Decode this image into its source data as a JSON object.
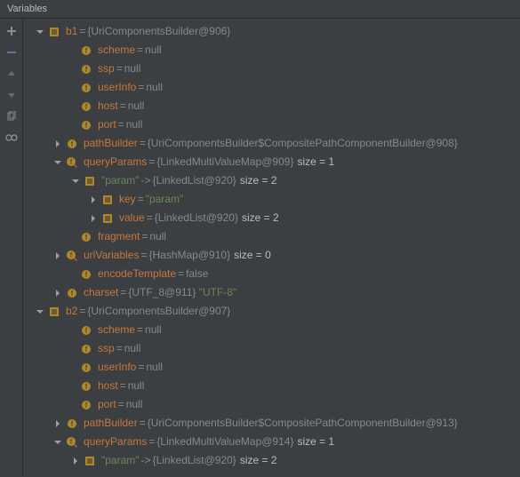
{
  "header": {
    "title": "Variables"
  },
  "gutter": {
    "icons": [
      "plus-icon",
      "minus-icon",
      "up-icon",
      "down-icon",
      "copy-icon",
      "link-icon"
    ]
  },
  "tree": {
    "b1": {
      "name": "b1",
      "type": "{UriComponentsBuilder@906}",
      "scheme": {
        "name": "scheme",
        "value": "null"
      },
      "ssp": {
        "name": "ssp",
        "value": "null"
      },
      "userInfo": {
        "name": "userInfo",
        "value": "null"
      },
      "host": {
        "name": "host",
        "value": "null"
      },
      "port": {
        "name": "port",
        "value": "null"
      },
      "pathBuilder": {
        "name": "pathBuilder",
        "type": "{UriComponentsBuilder$CompositePathComponentBuilder@908}"
      },
      "queryParams": {
        "name": "queryParams",
        "type": "{LinkedMultiValueMap@909}",
        "size": "size = 1",
        "entry": {
          "label": "\"param\"",
          "arrowSep": "->",
          "valType": "{LinkedList@920}",
          "size": "size = 2",
          "key": {
            "name": "key",
            "value": "\"param\""
          },
          "value": {
            "name": "value",
            "type": "{LinkedList@920}",
            "size": "size = 2"
          }
        }
      },
      "fragment": {
        "name": "fragment",
        "value": "null"
      },
      "uriVariables": {
        "name": "uriVariables",
        "type": "{HashMap@910}",
        "size": "size = 0"
      },
      "encodeTemplate": {
        "name": "encodeTemplate",
        "value": "false"
      },
      "charset": {
        "name": "charset",
        "type": "{UTF_8@911}",
        "str": "\"UTF-8\""
      }
    },
    "b2": {
      "name": "b2",
      "type": "{UriComponentsBuilder@907}",
      "scheme": {
        "name": "scheme",
        "value": "null"
      },
      "ssp": {
        "name": "ssp",
        "value": "null"
      },
      "userInfo": {
        "name": "userInfo",
        "value": "null"
      },
      "host": {
        "name": "host",
        "value": "null"
      },
      "port": {
        "name": "port",
        "value": "null"
      },
      "pathBuilder": {
        "name": "pathBuilder",
        "type": "{UriComponentsBuilder$CompositePathComponentBuilder@913}"
      },
      "queryParams": {
        "name": "queryParams",
        "type": "{LinkedMultiValueMap@914}",
        "size": "size = 1",
        "entry": {
          "label": "\"param\"",
          "arrowSep": "->",
          "valType": "{LinkedList@920}",
          "size": "size = 2"
        }
      }
    }
  }
}
